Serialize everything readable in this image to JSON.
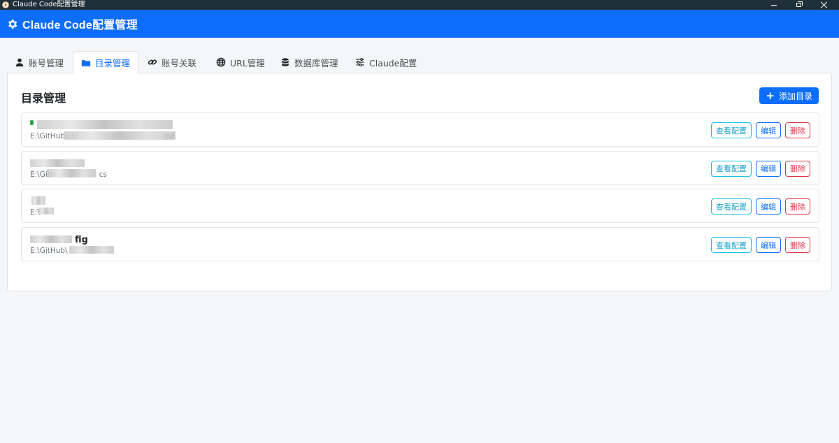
{
  "window": {
    "title": "Claude Code配置管理"
  },
  "header": {
    "title": "Claude Code配置管理",
    "icon": "gear-icon"
  },
  "tabs": [
    {
      "label": "账号管理",
      "icon": "user-icon",
      "active": false
    },
    {
      "label": "目录管理",
      "icon": "folder-icon",
      "active": true
    },
    {
      "label": "账号关联",
      "icon": "link-icon",
      "active": false
    },
    {
      "label": "URL管理",
      "icon": "globe-icon",
      "active": false
    },
    {
      "label": "数据库管理",
      "icon": "database-icon",
      "active": false
    },
    {
      "label": "Claude配置",
      "icon": "sliders-icon",
      "active": false
    }
  ],
  "panel": {
    "title": "目录管理",
    "add_button": "添加目录"
  },
  "directories": [
    {
      "name": "",
      "path": "E:\\GitHub\\cla",
      "path_suffix": "gui",
      "active": true
    },
    {
      "name": "",
      "path": "E:\\GitH",
      "path_suffix": "cs",
      "active": false
    },
    {
      "name": "",
      "path": "E:\\",
      "path_suffix": "",
      "active": false
    },
    {
      "name": "fig",
      "path": "E:\\GitHub\\",
      "path_suffix": "",
      "active": false
    }
  ],
  "row_actions": {
    "view": "查看配置",
    "edit": "编辑",
    "delete": "删除"
  },
  "colors": {
    "primary": "#0d6efd",
    "titlebar": "#20303a",
    "info": "#17c1e8",
    "danger": "#dc3545",
    "success": "#28a745"
  }
}
